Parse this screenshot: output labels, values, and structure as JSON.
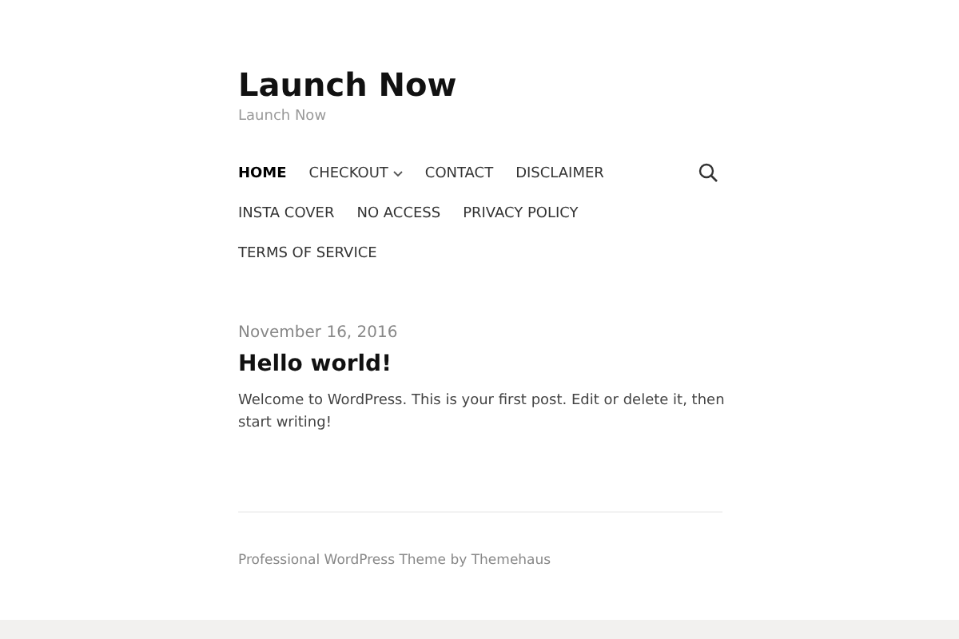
{
  "site": {
    "title": "Launch Now",
    "tagline": "Launch Now"
  },
  "nav": {
    "items": [
      {
        "label": "HOME",
        "selected": true,
        "has_submenu": false
      },
      {
        "label": "CHECKOUT",
        "selected": false,
        "has_submenu": true
      },
      {
        "label": "CONTACT",
        "selected": false,
        "has_submenu": false
      },
      {
        "label": "DISCLAIMER",
        "selected": false,
        "has_submenu": false
      },
      {
        "label": "INSTA COVER",
        "selected": false,
        "has_submenu": false
      },
      {
        "label": "NO ACCESS",
        "selected": false,
        "has_submenu": false
      },
      {
        "label": "PRIVACY POLICY",
        "selected": false,
        "has_submenu": false
      },
      {
        "label": "TERMS OF SERVICE",
        "selected": false,
        "has_submenu": false
      }
    ]
  },
  "post": {
    "date": "November 16, 2016",
    "title": "Hello world!",
    "excerpt": "Welcome to WordPress. This is your first post. Edit or delete it, then start writing!"
  },
  "footer": {
    "credit": "Professional WordPress Theme by Themehaus"
  }
}
